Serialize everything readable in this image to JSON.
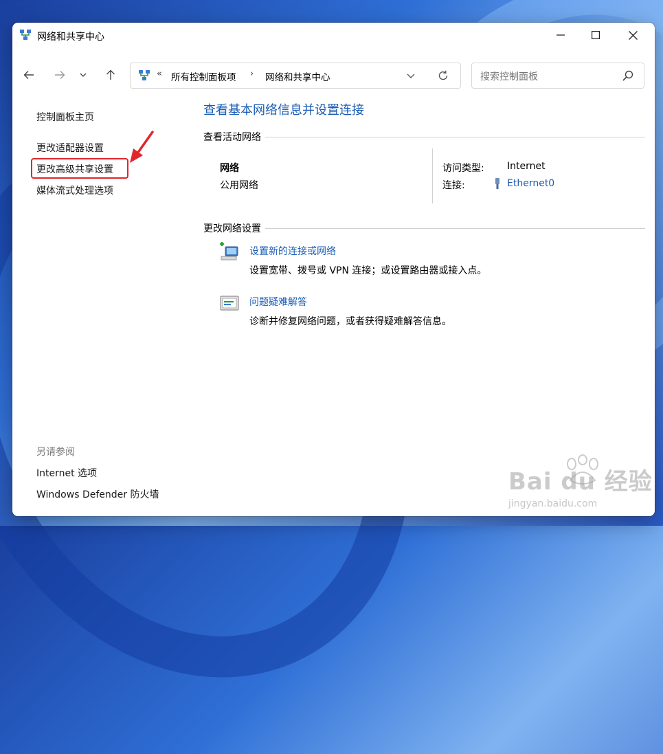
{
  "window": {
    "title": "网络和共享中心"
  },
  "navigation": {
    "back_icon": "arrow-left-icon",
    "forward_icon": "arrow-right-icon",
    "recent_icon": "chevron-down-icon",
    "up_icon": "arrow-up-icon"
  },
  "address_bar": {
    "overflow_chevron": "«",
    "crumb_parent": "所有控制面板项",
    "separator": "›",
    "crumb_current": "网络和共享中心"
  },
  "search": {
    "placeholder": "搜索控制面板"
  },
  "sidebar": {
    "home_link": "控制面板主页",
    "items": [
      {
        "label": "更改适配器设置"
      },
      {
        "label": "更改高级共享设置",
        "highlighted": true
      },
      {
        "label": "媒体流式处理选项"
      }
    ],
    "see_also_heading": "另请参阅",
    "see_also": [
      {
        "label": "Internet 选项"
      },
      {
        "label": "Windows Defender 防火墙"
      }
    ]
  },
  "main": {
    "title": "查看基本网络信息并设置连接",
    "active_networks_heading": "查看活动网络",
    "network": {
      "name": "网络",
      "profile": "公用网络",
      "access_type_label": "访问类型:",
      "access_type_value": "Internet",
      "connection_label": "连接:",
      "connection_value": "Ethernet0"
    },
    "change_settings_heading": "更改网络设置",
    "tasks": [
      {
        "title": "设置新的连接或网络",
        "description": "设置宽带、拨号或 VPN 连接；或设置路由器或接入点。",
        "icon": "new-connection-icon"
      },
      {
        "title": "问题疑难解答",
        "description": "诊断并修复网络问题，或者获得疑难解答信息。",
        "icon": "troubleshoot-icon"
      }
    ]
  },
  "annotation": {
    "highlight_color": "#e0262b"
  },
  "watermark": {
    "brand": "Bai du 经验",
    "url": "jingyan.baidu.com"
  },
  "colors": {
    "link": "#1a5cb5",
    "accent_red": "#e0262b"
  }
}
